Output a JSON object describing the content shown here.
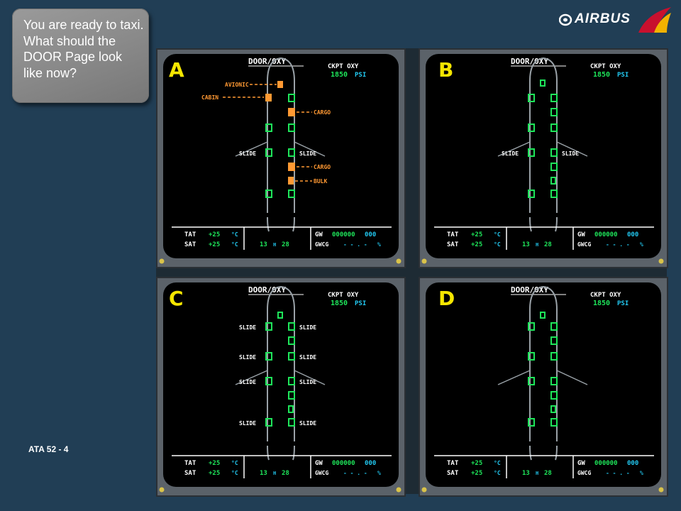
{
  "question": "You are ready to taxi. What should the DOOR Page look like now?",
  "footer_label": "ATA 52 - 4",
  "logo": {
    "text": "AIRBUS",
    "icon": "airbus-logo-icon",
    "accent_red": "#c8102e",
    "accent_yellow": "#f2b200"
  },
  "colors": {
    "screen_bg": "#000000",
    "white": "#ffffff",
    "green": "#1ee55a",
    "amber": "#ff9933",
    "cyan": "#22c8f0",
    "letter": "#f5e600"
  },
  "panels": [
    {
      "letter": "A",
      "page_title": "DOOR/OXY",
      "ckpt_oxy_label": "CKPT OXY",
      "ckpt_oxy_value": "1850",
      "ckpt_oxy_unit": "PSI",
      "door_labels": {
        "avionic": "AVIONIC",
        "cabin": "CABIN",
        "cargo_fwd": "CARGO",
        "slide_left": "SLIDE",
        "slide_right": "SLIDE",
        "cargo_aft": "CARGO",
        "bulk": "BULK"
      },
      "status": {
        "tat_label": "TAT",
        "tat_value": "+25",
        "tat_unit": "°C",
        "sat_label": "SAT",
        "sat_value": "+25",
        "sat_unit": "°C",
        "time_h": "13",
        "time_h_unit": "H",
        "time_m": "28",
        "gw_label": "GW",
        "gw_value": "000000",
        "gw_unit": "000",
        "gwcg_label": "GWCG",
        "gwcg_value": "- - . -",
        "gwcg_unit": "%"
      }
    },
    {
      "letter": "B",
      "page_title": "DOOR/OXY",
      "ckpt_oxy_label": "CKPT OXY",
      "ckpt_oxy_value": "1850",
      "ckpt_oxy_unit": "PSI",
      "door_labels": {
        "slide_left": "SLIDE",
        "slide_right": "SLIDE"
      },
      "status": {
        "tat_label": "TAT",
        "tat_value": "+25",
        "tat_unit": "°C",
        "sat_label": "SAT",
        "sat_value": "+25",
        "sat_unit": "°C",
        "time_h": "13",
        "time_h_unit": "H",
        "time_m": "28",
        "gw_label": "GW",
        "gw_value": "000000",
        "gw_unit": "000",
        "gwcg_label": "GWCG",
        "gwcg_value": "- - . -",
        "gwcg_unit": "%"
      }
    },
    {
      "letter": "C",
      "page_title": "DOOR/OXY",
      "ckpt_oxy_label": "CKPT OXY",
      "ckpt_oxy_value": "1850",
      "ckpt_oxy_unit": "PSI",
      "door_labels": {
        "slide_1l": "SLIDE",
        "slide_1r": "SLIDE",
        "slide_2l": "SLIDE",
        "slide_2r": "SLIDE",
        "slide_3l": "SLIDE",
        "slide_3r": "SLIDE",
        "slide_4l": "SLIDE",
        "slide_4r": "SLIDE"
      },
      "status": {
        "tat_label": "TAT",
        "tat_value": "+25",
        "tat_unit": "°C",
        "sat_label": "SAT",
        "sat_value": "+25",
        "sat_unit": "°C",
        "time_h": "13",
        "time_h_unit": "H",
        "time_m": "28",
        "gw_label": "GW",
        "gw_value": "000000",
        "gw_unit": "000",
        "gwcg_label": "GWCG",
        "gwcg_value": "- - . -",
        "gwcg_unit": "%"
      }
    },
    {
      "letter": "D",
      "page_title": "DOOR/OXY",
      "ckpt_oxy_label": "CKPT OXY",
      "ckpt_oxy_value": "1850",
      "ckpt_oxy_unit": "PSI",
      "door_labels": {},
      "status": {
        "tat_label": "TAT",
        "tat_value": "+25",
        "tat_unit": "°C",
        "sat_label": "SAT",
        "sat_value": "+25",
        "sat_unit": "°C",
        "time_h": "13",
        "time_h_unit": "H",
        "time_m": "28",
        "gw_label": "GW",
        "gw_value": "000000",
        "gw_unit": "000",
        "gwcg_label": "GWCG",
        "gwcg_value": "- - . -",
        "gwcg_unit": "%"
      }
    }
  ]
}
